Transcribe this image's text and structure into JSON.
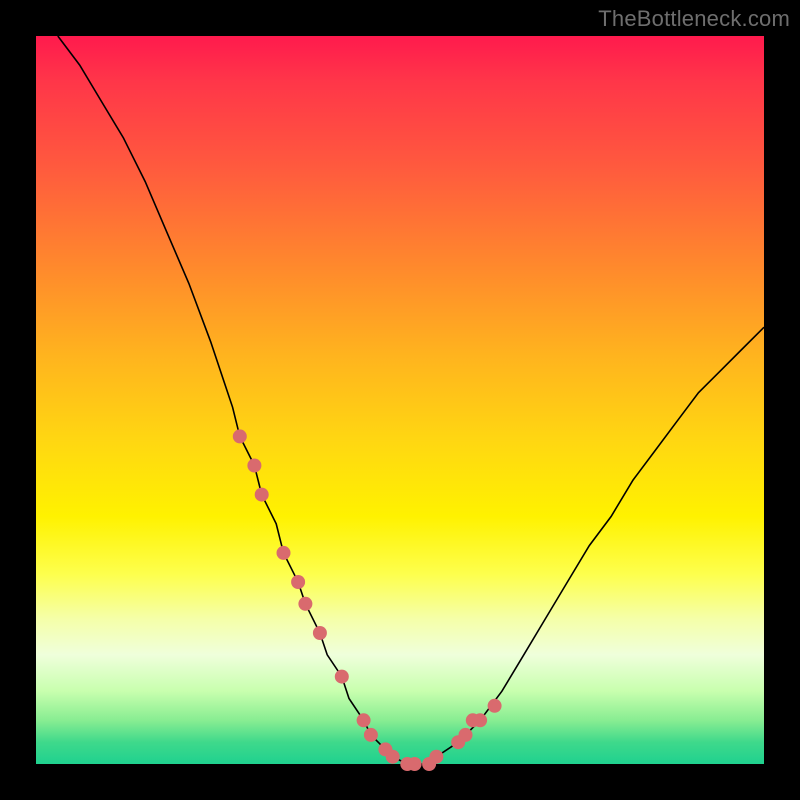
{
  "watermark": "TheBottleneck.com",
  "colors": {
    "frame": "#000000",
    "curve_stroke": "#000000",
    "dot_fill": "#d96a6e",
    "gradient_top": "#ff1a4d",
    "gradient_bottom": "#1fd18f"
  },
  "chart_data": {
    "type": "line",
    "title": "",
    "xlabel": "",
    "ylabel": "",
    "xlim": [
      0,
      100
    ],
    "ylim": [
      0,
      100
    ],
    "grid": false,
    "legend": false,
    "series": [
      {
        "name": "bottleneck-curve",
        "x": [
          3,
          6,
          9,
          12,
          15,
          18,
          21,
          24,
          27,
          28,
          30,
          31,
          33,
          34,
          36,
          37,
          39,
          40,
          42,
          43,
          45,
          46,
          48,
          49,
          51,
          52,
          54,
          55,
          58,
          61,
          64,
          67,
          70,
          73,
          76,
          79,
          82,
          85,
          88,
          91,
          94,
          97,
          100
        ],
        "values": [
          100,
          96,
          91,
          86,
          80,
          73,
          66,
          58,
          49,
          45,
          41,
          37,
          33,
          29,
          25,
          22,
          18,
          15,
          12,
          9,
          6,
          4,
          2,
          1,
          0,
          0,
          0,
          1,
          3,
          6,
          10,
          15,
          20,
          25,
          30,
          34,
          39,
          43,
          47,
          51,
          54,
          57,
          60
        ]
      }
    ],
    "markers": {
      "name": "highlighted-points",
      "x": [
        28,
        30,
        31,
        34,
        36,
        37,
        39,
        42,
        45,
        46,
        48,
        49,
        51,
        52,
        54,
        55,
        58,
        59,
        60,
        61,
        63
      ],
      "values": [
        45,
        41,
        37,
        29,
        25,
        22,
        18,
        12,
        6,
        4,
        2,
        1,
        0,
        0,
        0,
        1,
        3,
        4,
        6,
        6,
        8
      ]
    }
  }
}
